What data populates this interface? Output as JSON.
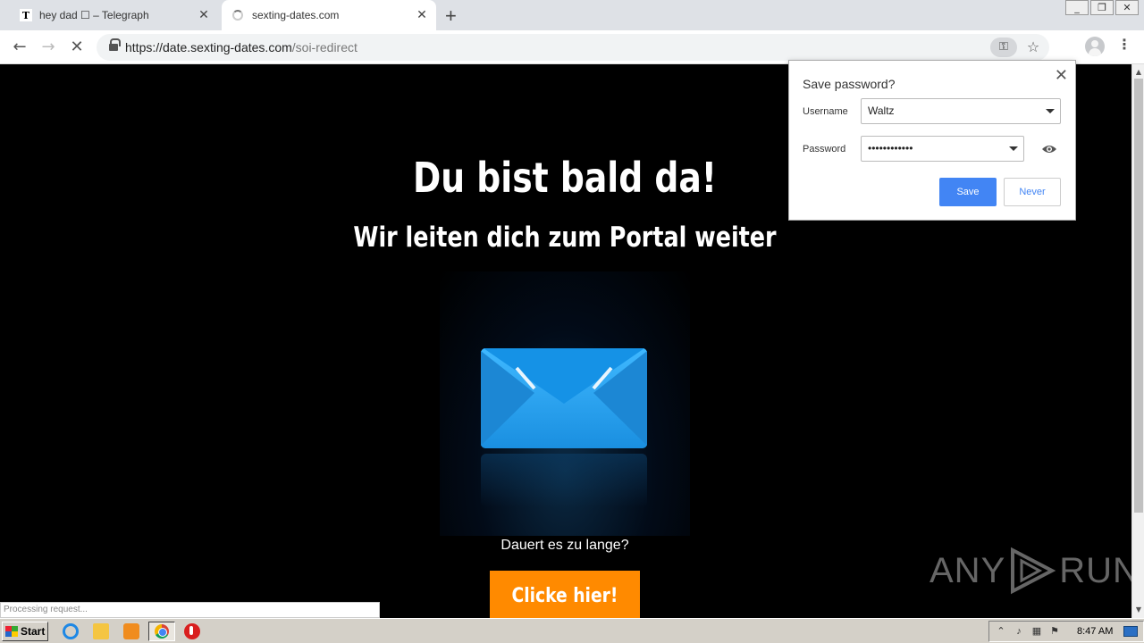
{
  "browser": {
    "tabs": [
      {
        "favicon": "T",
        "title": "hey dad ☐ – Telegraph",
        "close": "✕"
      },
      {
        "title": "sexting-dates.com",
        "close": "✕"
      }
    ],
    "new_tab": "+",
    "url_host": "https://date.sexting-dates.com",
    "url_path": "/soi-redirect"
  },
  "page": {
    "heading": "Du bist bald da!",
    "subheading": "Wir leiten dich zum Portal weiter",
    "question": "Dauert es zu lange?",
    "cta_label": "Clicke hier!",
    "status_text": "Processing request..."
  },
  "password_bubble": {
    "title": "Save password?",
    "close": "✕",
    "username_label": "Username",
    "username_value": "Waltz",
    "password_label": "Password",
    "password_value": "••••••••••••",
    "save_label": "Save",
    "never_label": "Never"
  },
  "watermark": {
    "left": "ANY",
    "right": "RUN"
  },
  "taskbar": {
    "start_label": "Start",
    "clock": "8:47 AM"
  },
  "colors": {
    "cta": "#ff8a00",
    "save_button": "#4285f4",
    "envelope": "#1e9be8"
  }
}
